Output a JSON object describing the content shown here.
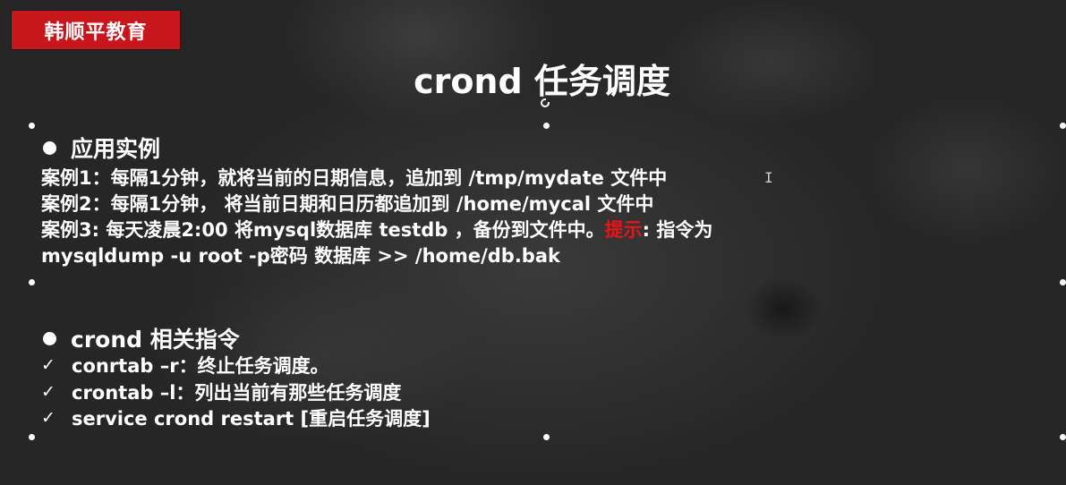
{
  "logo": {
    "text": "韩顺平教育",
    "color": "#c8161d"
  },
  "slide": {
    "title": "crond 任务调度"
  },
  "section_examples": {
    "heading": "应用实例",
    "lines": [
      "案例1：每隔1分钟，就将当前的日期信息，追加到 /tmp/mydate 文件中",
      "案例2：每隔1分钟， 将当前日期和日历都追加到 /home/mycal 文件中"
    ],
    "case3_text": "案例3:  每天凌晨2:00 将mysql数据库 testdb ，备份到文件中。",
    "case3_hint": "提示",
    "case3_rest": ": 指令为",
    "case3_line2": "mysqldump -u root -p密码 数据库 >> /home/db.bak"
  },
  "section_commands": {
    "heading": "crond 相关指令",
    "check_icon": "✓",
    "items": [
      "conrtab –r：终止任务调度。",
      "crontab –l：列出当前有那些任务调度",
      "service crond restart   [重启任务调度]"
    ]
  },
  "colors": {
    "hint": "#e8141b",
    "text": "#ffffff"
  },
  "cursor_glyph": "I"
}
